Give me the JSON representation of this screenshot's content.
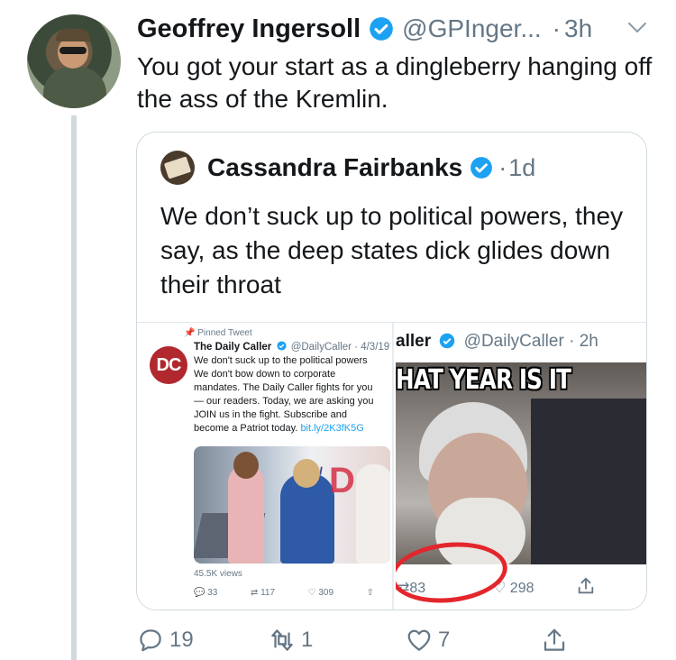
{
  "tweet": {
    "name": "Geoffrey Ingersoll",
    "handle": "@GPInger...",
    "separator": "·",
    "time": "3h",
    "text": "You got your start as a dingleberry hanging off the ass of the Kremlin.",
    "actions": {
      "replies": "19",
      "retweets": "1",
      "likes": "7"
    }
  },
  "quote": {
    "name": "Cassandra Fairbanks",
    "separator": "·",
    "time": "1d",
    "text": "We don’t suck up to political powers, they say, as the deep states dick glides down their throat"
  },
  "screenshot_left": {
    "pinned_label": "Pinned Tweet",
    "logo_text": "DC",
    "name": "The Daily Caller",
    "handle": "@DailyCaller",
    "date": "· 4/3/19",
    "text": "We don't suck up to the political powers\nWe don't bow down to corporate\nmandates. The Daily Caller fights for you\n— our readers. Today, we are asking you\nJOIN us in the fight. Subscribe and\nbecome a Patriot today.",
    "link": "bit.ly/2K3fK5G",
    "views": "45.5K views",
    "replies": "33",
    "retweets": "117",
    "likes": "309"
  },
  "screenshot_right": {
    "name_fragment": "aller",
    "handle": "@DailyCaller",
    "time": "· 2h",
    "meme_caption": "HAT YEAR IS IT",
    "replies": "83",
    "likes": "298"
  },
  "colors": {
    "verified": "#1da1f2",
    "secondary": "#657786",
    "text": "#14171a",
    "border": "#cfd9de",
    "annotation": "#e3262c"
  }
}
